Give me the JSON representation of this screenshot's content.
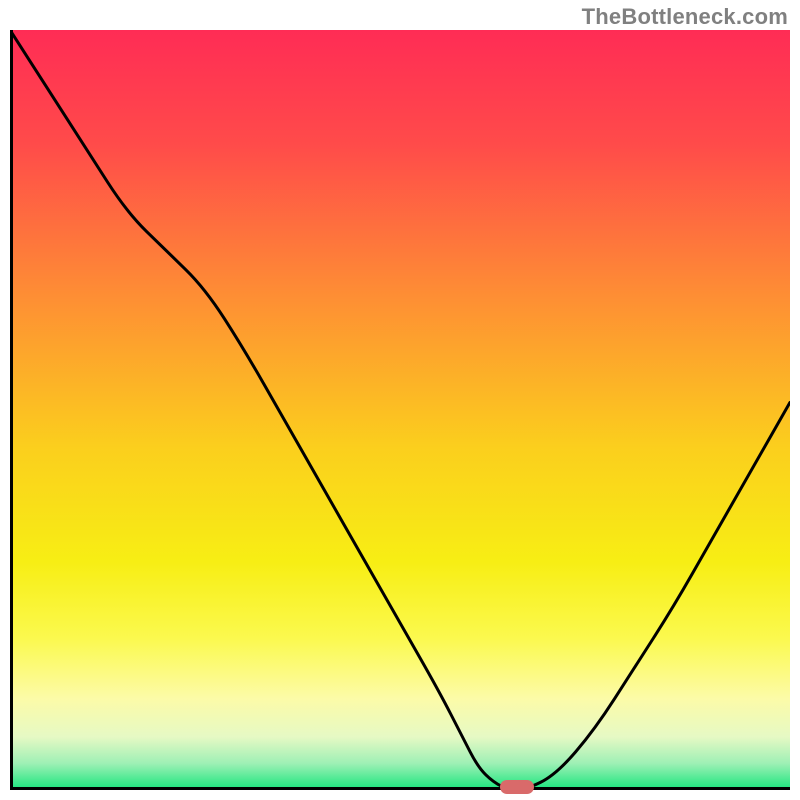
{
  "watermark": "TheBottleneck.com",
  "chart_data": {
    "type": "line",
    "title": "",
    "xlabel": "",
    "ylabel": "",
    "xlim": [
      0,
      100
    ],
    "ylim": [
      0,
      100
    ],
    "x": [
      0,
      5,
      10,
      15,
      20,
      25,
      30,
      35,
      40,
      45,
      50,
      55,
      58,
      60,
      62,
      64,
      66,
      70,
      75,
      80,
      85,
      90,
      95,
      100
    ],
    "values": [
      100,
      92,
      84,
      76,
      71,
      66,
      58,
      49,
      40,
      31,
      22,
      13,
      7,
      3,
      1,
      0,
      0,
      2,
      8,
      16,
      24,
      33,
      42,
      51
    ],
    "marker": {
      "x": 65,
      "y": 0
    },
    "gradient_stops": [
      {
        "pos": 0.0,
        "color": "#ff2c55"
      },
      {
        "pos": 0.15,
        "color": "#ff4b4a"
      },
      {
        "pos": 0.35,
        "color": "#fe8e34"
      },
      {
        "pos": 0.55,
        "color": "#fbcf1d"
      },
      {
        "pos": 0.7,
        "color": "#f7ee14"
      },
      {
        "pos": 0.8,
        "color": "#fbf94e"
      },
      {
        "pos": 0.88,
        "color": "#fcfba8"
      },
      {
        "pos": 0.93,
        "color": "#e6f9c4"
      },
      {
        "pos": 0.965,
        "color": "#9ef0b5"
      },
      {
        "pos": 1.0,
        "color": "#17e57c"
      }
    ]
  }
}
